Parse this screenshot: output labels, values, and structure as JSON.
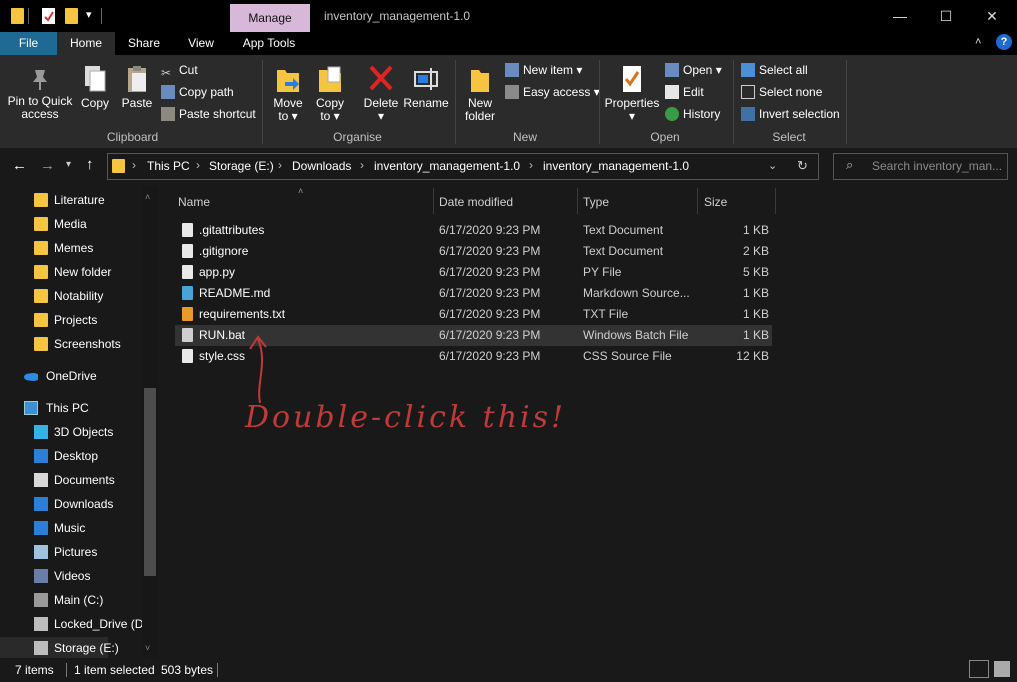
{
  "titlebar": {
    "manage_label": "Manage",
    "window_title": "inventory_management-1.0",
    "minimize_glyph": "—",
    "maximize_glyph": "☐",
    "close_glyph": "✕"
  },
  "tabs": {
    "file": "File",
    "home": "Home",
    "share": "Share",
    "view": "View",
    "app_tools": "App Tools"
  },
  "ribbon": {
    "clipboard": {
      "label": "Clipboard",
      "pin_line1": "Pin to Quick",
      "pin_line2": "access",
      "copy": "Copy",
      "paste": "Paste",
      "cut": "Cut",
      "copy_path": "Copy path",
      "paste_shortcut": "Paste shortcut"
    },
    "organise": {
      "label": "Organise",
      "move_line1": "Move",
      "move_line2": "to ▾",
      "copy_line1": "Copy",
      "copy_line2": "to ▾",
      "delete_line1": "Delete",
      "delete_line2": "▾",
      "rename": "Rename"
    },
    "new": {
      "label": "New",
      "folder_line1": "New",
      "folder_line2": "folder",
      "new_item": "New item ▾",
      "easy_access": "Easy access ▾"
    },
    "open": {
      "label": "Open",
      "properties_line1": "Properties",
      "properties_line2": "▾",
      "open": "Open ▾",
      "edit": "Edit",
      "history": "History"
    },
    "select": {
      "label": "Select",
      "select_all": "Select all",
      "select_none": "Select none",
      "invert": "Invert selection"
    }
  },
  "address": {
    "crumbs": [
      "This PC",
      "Storage (E:)",
      "Downloads",
      "inventory_management-1.0",
      "inventory_management-1.0"
    ],
    "search_placeholder": "Search inventory_man..."
  },
  "nav": {
    "quick": [
      "Literature",
      "Media",
      "Memes",
      "New folder",
      "Notability",
      "Projects",
      "Screenshots"
    ],
    "onedrive": "OneDrive",
    "thispc": "This PC",
    "pc_items": [
      "3D Objects",
      "Desktop",
      "Documents",
      "Downloads",
      "Music",
      "Pictures",
      "Videos",
      "Main (C:)",
      "Locked_Drive (D",
      "Storage (E:)"
    ]
  },
  "columns": {
    "name": "Name",
    "date": "Date modified",
    "type": "Type",
    "size": "Size"
  },
  "files": [
    {
      "name": ".gitattributes",
      "date": "6/17/2020 9:23 PM",
      "type": "Text Document",
      "size": "1 KB"
    },
    {
      "name": ".gitignore",
      "date": "6/17/2020 9:23 PM",
      "type": "Text Document",
      "size": "2 KB"
    },
    {
      "name": "app.py",
      "date": "6/17/2020 9:23 PM",
      "type": "PY File",
      "size": "5 KB"
    },
    {
      "name": "README.md",
      "date": "6/17/2020 9:23 PM",
      "type": "Markdown Source...",
      "size": "1 KB"
    },
    {
      "name": "requirements.txt",
      "date": "6/17/2020 9:23 PM",
      "type": "TXT File",
      "size": "1 KB"
    },
    {
      "name": "RUN.bat",
      "date": "6/17/2020 9:23 PM",
      "type": "Windows Batch File",
      "size": "1 KB"
    },
    {
      "name": "style.css",
      "date": "6/17/2020 9:23 PM",
      "type": "CSS Source File",
      "size": "12 KB"
    }
  ],
  "annotation": "Double-click this!",
  "status": {
    "items": "7 items",
    "selected": "1 item selected",
    "bytes": "503 bytes"
  },
  "colors": {
    "accent_file_tab": "#1f6a94",
    "manage_tab": "#d8b8d8",
    "annotation": "#c03a3a",
    "folder": "#f5c542"
  }
}
